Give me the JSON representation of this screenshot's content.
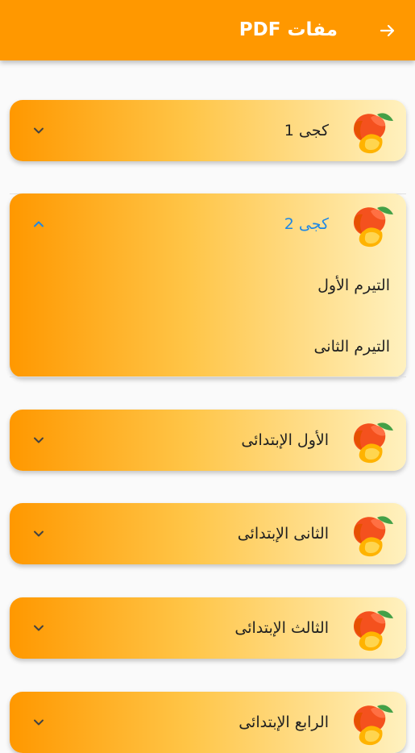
{
  "appbar": {
    "title": "مفات PDF",
    "back_icon": "arrow-forward-icon",
    "background": "#ff9800"
  },
  "sections": [
    {
      "label": "كجى 1",
      "expanded": false,
      "icon": "mango-icon",
      "toggle_icon": "chevron-down-icon"
    },
    {
      "label": "كجى 2",
      "expanded": true,
      "icon": "mango-icon",
      "toggle_icon": "chevron-up-icon",
      "children": [
        {
          "label": "التيرم  الأول"
        },
        {
          "label": "التيرم الثانى"
        }
      ]
    },
    {
      "label": "الأول الإبتدائى",
      "expanded": false,
      "icon": "mango-icon",
      "toggle_icon": "chevron-down-icon"
    },
    {
      "label": "الثانى الإبتدائى",
      "expanded": false,
      "icon": "mango-icon",
      "toggle_icon": "chevron-down-icon"
    },
    {
      "label": "الثالث الإبتدائى",
      "expanded": false,
      "icon": "mango-icon",
      "toggle_icon": "chevron-down-icon"
    },
    {
      "label": "الرابع الإبتدائى",
      "expanded": false,
      "icon": "mango-icon",
      "toggle_icon": "chevron-down-icon"
    }
  ],
  "colors": {
    "accent": "#ff9800",
    "active_text": "#1e88e5",
    "card_gradient_start": "#ff9800",
    "card_gradient_end": "#fff1bf"
  }
}
